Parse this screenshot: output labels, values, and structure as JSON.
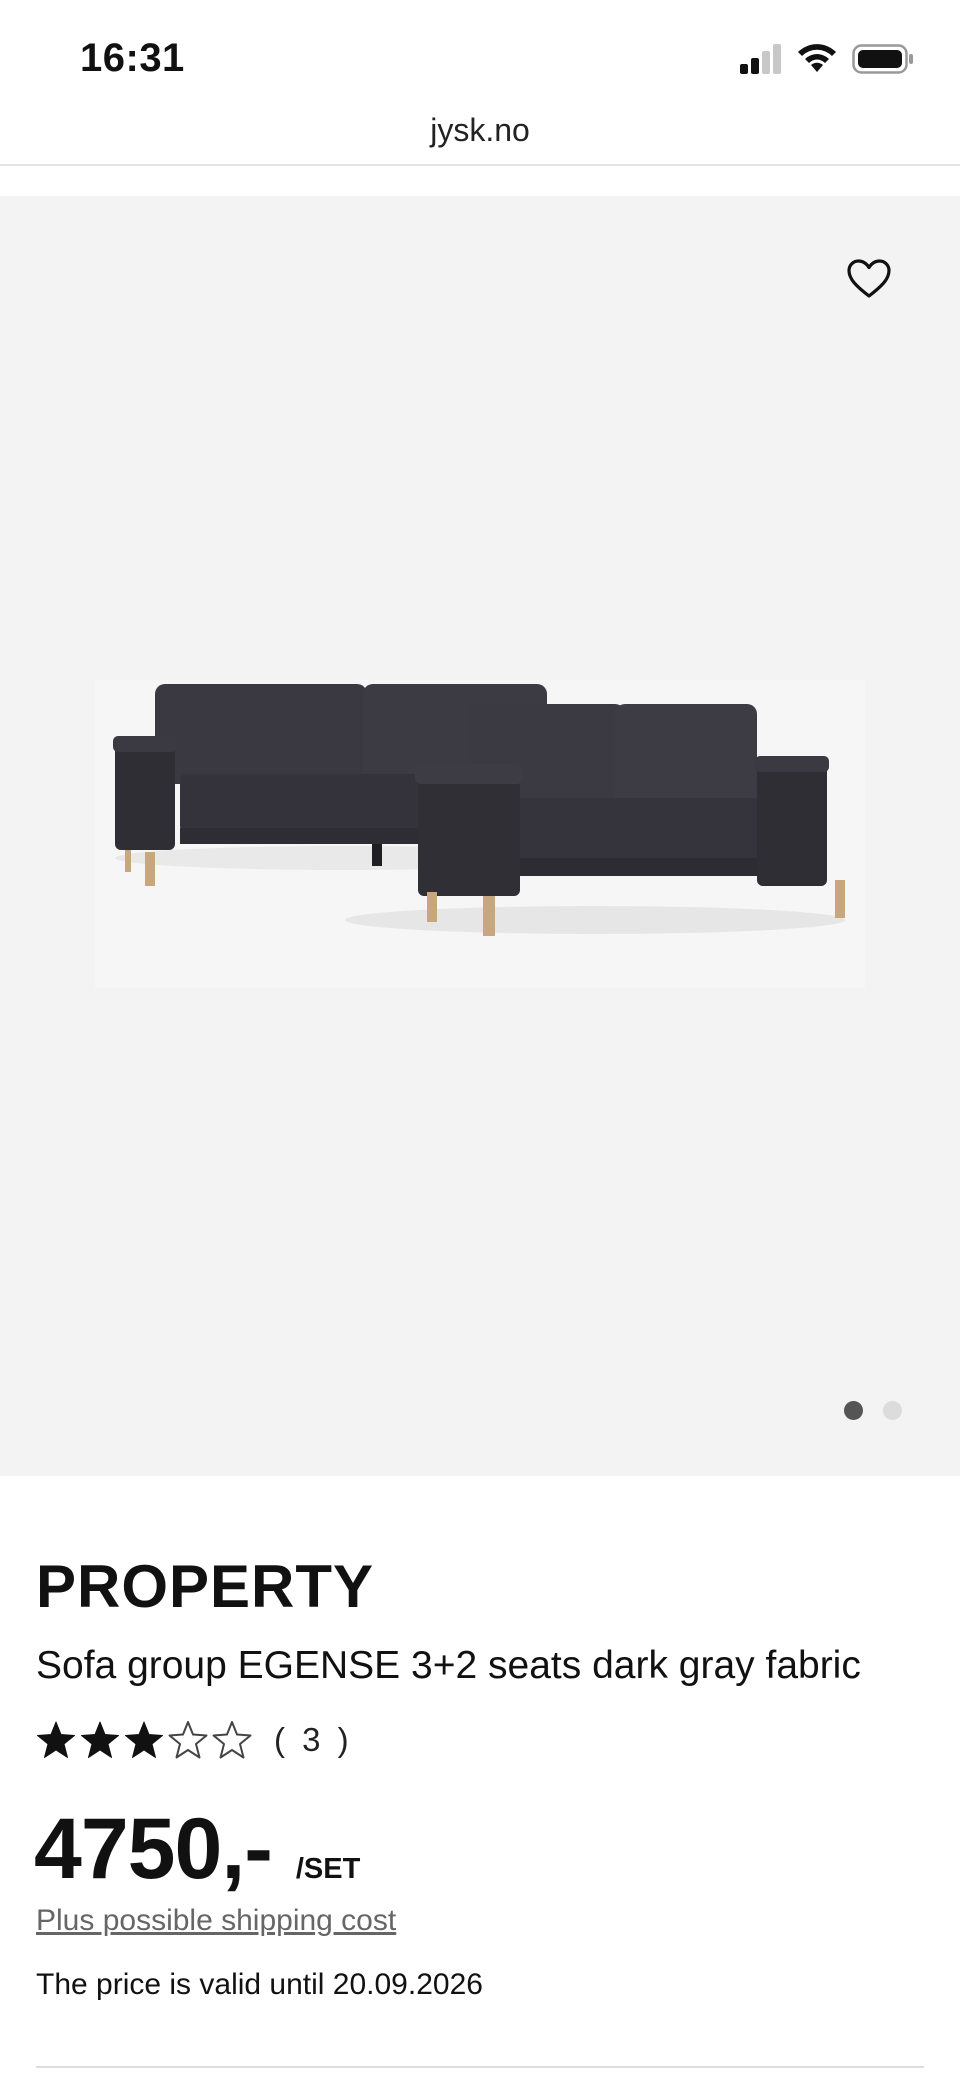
{
  "status_bar": {
    "time": "16:31",
    "icons": [
      "signal-icon",
      "wifi-icon",
      "battery-icon"
    ]
  },
  "browser": {
    "url": "jysk.no"
  },
  "gallery": {
    "favorite_icon": "heart-icon",
    "image_alt": "sofa-group-image",
    "page_count": 2,
    "current_page": 1
  },
  "product": {
    "brand": "PROPERTY",
    "title": "Sofa group EGENSE 3+2 seats dark gray fabric",
    "rating": 3,
    "rating_max": 5,
    "rating_count": "( 3 )",
    "price": "4750,-",
    "unit": "/SET",
    "shipping_link": "Plus possible shipping cost",
    "validity": "The price is valid until 20.09.2026"
  },
  "colors": {
    "gallery_bg": "#f3f3f4",
    "text": "#111111",
    "link": "#666666"
  }
}
